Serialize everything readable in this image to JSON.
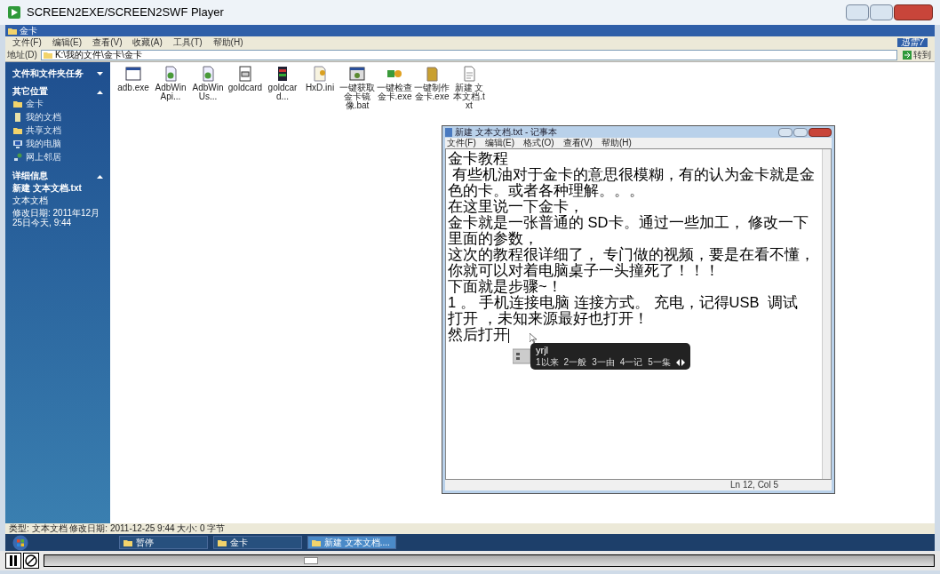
{
  "player": {
    "title": "SCREEN2EXE/SCREEN2SWF Player",
    "seek": {
      "level": 0.3
    },
    "paused": true
  },
  "explorer": {
    "title": "金卡",
    "menu": [
      "文件(F)",
      "编辑(E)",
      "查看(V)",
      "收藏(A)",
      "工具(T)",
      "帮助(H)"
    ],
    "address_label": "地址(D)",
    "address": "K:\\我的文件\\金卡\\金卡",
    "toolbar_brand": "迅雷7",
    "go_button": "转到",
    "sidebar": [
      {
        "title": "文件和文件夹任务",
        "expanded": false
      },
      {
        "title": "其它位置",
        "expanded": true,
        "items": [
          {
            "label": "金卡",
            "kind": "folder"
          },
          {
            "label": "我的文档",
            "kind": "docs"
          },
          {
            "label": "共享文档",
            "kind": "folder"
          },
          {
            "label": "我的电脑",
            "kind": "computer"
          },
          {
            "label": "网上邻居",
            "kind": "network"
          }
        ]
      },
      {
        "title": "详细信息",
        "expanded": true,
        "details": [
          "新建 文本文档.txt",
          "文本文档",
          "修改日期: 2011年12月25日今天, 9:44"
        ]
      }
    ],
    "files": [
      {
        "name": "adb.exe",
        "kind": "window"
      },
      {
        "name": "AdbWinApi...",
        "kind": "lib"
      },
      {
        "name": "AdbWinUs...",
        "kind": "lib"
      },
      {
        "name": "goldcard",
        "kind": "program"
      },
      {
        "name": "goldcard...",
        "kind": "archive"
      },
      {
        "name": "HxD.ini",
        "kind": "settings"
      },
      {
        "name": "一键获取金卡镜像.bat",
        "kind": "script"
      },
      {
        "name": "一键检查金卡.exe",
        "kind": "hex"
      },
      {
        "name": "一键制作金卡.exe",
        "kind": "card"
      },
      {
        "name": "新建 文本文档.txt",
        "kind": "text"
      }
    ],
    "status_bar": "类型: 文本文档 修改日期: 2011-12-25 9:44 大小: 0 字节"
  },
  "notepad": {
    "title": "新建 文本文档.txt - 记事本",
    "menu": [
      "文件(F)",
      "编辑(E)",
      "格式(O)",
      "查看(V)",
      "帮助(H)"
    ],
    "lines": [
      "金卡教程",
      " 有些机油对于金卡的意思很模糊，有的认为金卡就是金",
      "色的卡。或者各种理解。。。",
      "在这里说一下金卡，",
      "金卡就是一张普通的 SD卡。通过一些加工， 修改一下",
      "里面的参数，",
      "这次的教程很详细了， 专门做的视频，要是在看不懂，",
      "你就可以对着电脑桌子一头撞死了！！！",
      "下面就是步骤~！",
      "1 。 手机连接电脑 连接方式。 充电，记得USB  调试",
      "打开 ，未知来源最好也打开！",
      "然后打开"
    ],
    "status": "Ln 12, Col 5"
  },
  "ime": {
    "input": "yrjl",
    "candidates": [
      "1以来",
      "2一般",
      "3一由",
      "4一记",
      "5一集"
    ]
  },
  "taskbar": [
    {
      "label": "暂停",
      "selected": false
    },
    {
      "label": "金卡",
      "selected": false
    },
    {
      "label": "新建 文本文档....",
      "selected": true
    }
  ]
}
